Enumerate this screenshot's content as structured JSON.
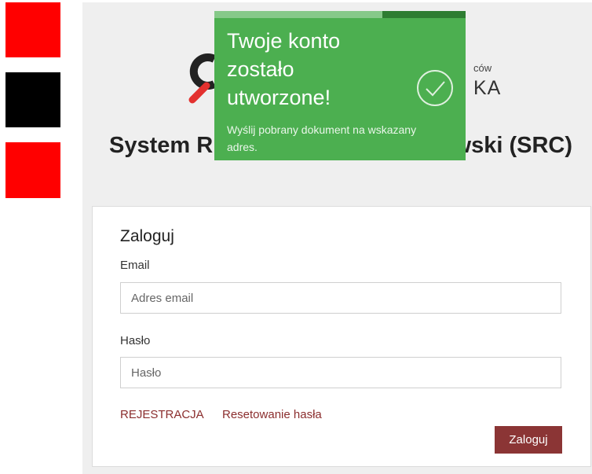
{
  "side_blocks": [
    {
      "color": "#ff0000"
    },
    {
      "color": "#000000"
    },
    {
      "color": "#ff0000"
    }
  ],
  "header": {
    "logo_text_small": "ców",
    "logo_text_big": "KA",
    "system_title_left": "System R",
    "system_title_right": "wski (SRC)"
  },
  "toast": {
    "title": "Twoje konto zostało utworzone!",
    "message": "Wyślij pobrany dokument na wskazany adres.",
    "progress": 0.67,
    "icon": "check-circle-icon",
    "color": "#4caf50"
  },
  "login": {
    "heading": "Zaloguj",
    "email_label": "Email",
    "email_placeholder": "Adres email",
    "email_value": "",
    "password_label": "Hasło",
    "password_placeholder": "Hasło",
    "password_value": "",
    "register_link": "REJESTRACJA",
    "reset_link": "Resetowanie hasła",
    "submit_label": "Zaloguj",
    "accent_color": "#8b3535"
  }
}
